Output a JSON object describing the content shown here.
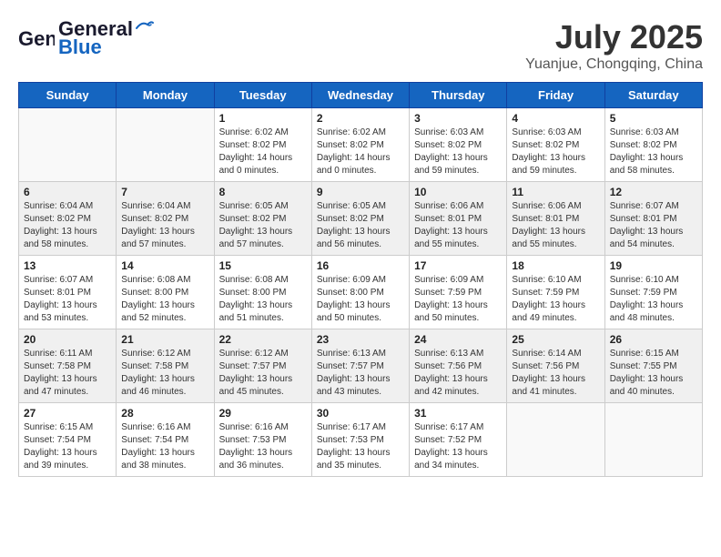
{
  "header": {
    "logo_general": "General",
    "logo_blue": "Blue",
    "title": "July 2025",
    "subtitle": "Yuanjue, Chongqing, China"
  },
  "days_of_week": [
    "Sunday",
    "Monday",
    "Tuesday",
    "Wednesday",
    "Thursday",
    "Friday",
    "Saturday"
  ],
  "weeks": [
    {
      "shaded": false,
      "days": [
        {
          "num": "",
          "empty": true
        },
        {
          "num": "",
          "empty": true
        },
        {
          "num": "1",
          "line1": "Sunrise: 6:02 AM",
          "line2": "Sunset: 8:02 PM",
          "line3": "Daylight: 14 hours",
          "line4": "and 0 minutes."
        },
        {
          "num": "2",
          "line1": "Sunrise: 6:02 AM",
          "line2": "Sunset: 8:02 PM",
          "line3": "Daylight: 14 hours",
          "line4": "and 0 minutes."
        },
        {
          "num": "3",
          "line1": "Sunrise: 6:03 AM",
          "line2": "Sunset: 8:02 PM",
          "line3": "Daylight: 13 hours",
          "line4": "and 59 minutes."
        },
        {
          "num": "4",
          "line1": "Sunrise: 6:03 AM",
          "line2": "Sunset: 8:02 PM",
          "line3": "Daylight: 13 hours",
          "line4": "and 59 minutes."
        },
        {
          "num": "5",
          "line1": "Sunrise: 6:03 AM",
          "line2": "Sunset: 8:02 PM",
          "line3": "Daylight: 13 hours",
          "line4": "and 58 minutes."
        }
      ]
    },
    {
      "shaded": true,
      "days": [
        {
          "num": "6",
          "line1": "Sunrise: 6:04 AM",
          "line2": "Sunset: 8:02 PM",
          "line3": "Daylight: 13 hours",
          "line4": "and 58 minutes."
        },
        {
          "num": "7",
          "line1": "Sunrise: 6:04 AM",
          "line2": "Sunset: 8:02 PM",
          "line3": "Daylight: 13 hours",
          "line4": "and 57 minutes."
        },
        {
          "num": "8",
          "line1": "Sunrise: 6:05 AM",
          "line2": "Sunset: 8:02 PM",
          "line3": "Daylight: 13 hours",
          "line4": "and 57 minutes."
        },
        {
          "num": "9",
          "line1": "Sunrise: 6:05 AM",
          "line2": "Sunset: 8:02 PM",
          "line3": "Daylight: 13 hours",
          "line4": "and 56 minutes."
        },
        {
          "num": "10",
          "line1": "Sunrise: 6:06 AM",
          "line2": "Sunset: 8:01 PM",
          "line3": "Daylight: 13 hours",
          "line4": "and 55 minutes."
        },
        {
          "num": "11",
          "line1": "Sunrise: 6:06 AM",
          "line2": "Sunset: 8:01 PM",
          "line3": "Daylight: 13 hours",
          "line4": "and 55 minutes."
        },
        {
          "num": "12",
          "line1": "Sunrise: 6:07 AM",
          "line2": "Sunset: 8:01 PM",
          "line3": "Daylight: 13 hours",
          "line4": "and 54 minutes."
        }
      ]
    },
    {
      "shaded": false,
      "days": [
        {
          "num": "13",
          "line1": "Sunrise: 6:07 AM",
          "line2": "Sunset: 8:01 PM",
          "line3": "Daylight: 13 hours",
          "line4": "and 53 minutes."
        },
        {
          "num": "14",
          "line1": "Sunrise: 6:08 AM",
          "line2": "Sunset: 8:00 PM",
          "line3": "Daylight: 13 hours",
          "line4": "and 52 minutes."
        },
        {
          "num": "15",
          "line1": "Sunrise: 6:08 AM",
          "line2": "Sunset: 8:00 PM",
          "line3": "Daylight: 13 hours",
          "line4": "and 51 minutes."
        },
        {
          "num": "16",
          "line1": "Sunrise: 6:09 AM",
          "line2": "Sunset: 8:00 PM",
          "line3": "Daylight: 13 hours",
          "line4": "and 50 minutes."
        },
        {
          "num": "17",
          "line1": "Sunrise: 6:09 AM",
          "line2": "Sunset: 7:59 PM",
          "line3": "Daylight: 13 hours",
          "line4": "and 50 minutes."
        },
        {
          "num": "18",
          "line1": "Sunrise: 6:10 AM",
          "line2": "Sunset: 7:59 PM",
          "line3": "Daylight: 13 hours",
          "line4": "and 49 minutes."
        },
        {
          "num": "19",
          "line1": "Sunrise: 6:10 AM",
          "line2": "Sunset: 7:59 PM",
          "line3": "Daylight: 13 hours",
          "line4": "and 48 minutes."
        }
      ]
    },
    {
      "shaded": true,
      "days": [
        {
          "num": "20",
          "line1": "Sunrise: 6:11 AM",
          "line2": "Sunset: 7:58 PM",
          "line3": "Daylight: 13 hours",
          "line4": "and 47 minutes."
        },
        {
          "num": "21",
          "line1": "Sunrise: 6:12 AM",
          "line2": "Sunset: 7:58 PM",
          "line3": "Daylight: 13 hours",
          "line4": "and 46 minutes."
        },
        {
          "num": "22",
          "line1": "Sunrise: 6:12 AM",
          "line2": "Sunset: 7:57 PM",
          "line3": "Daylight: 13 hours",
          "line4": "and 45 minutes."
        },
        {
          "num": "23",
          "line1": "Sunrise: 6:13 AM",
          "line2": "Sunset: 7:57 PM",
          "line3": "Daylight: 13 hours",
          "line4": "and 43 minutes."
        },
        {
          "num": "24",
          "line1": "Sunrise: 6:13 AM",
          "line2": "Sunset: 7:56 PM",
          "line3": "Daylight: 13 hours",
          "line4": "and 42 minutes."
        },
        {
          "num": "25",
          "line1": "Sunrise: 6:14 AM",
          "line2": "Sunset: 7:56 PM",
          "line3": "Daylight: 13 hours",
          "line4": "and 41 minutes."
        },
        {
          "num": "26",
          "line1": "Sunrise: 6:15 AM",
          "line2": "Sunset: 7:55 PM",
          "line3": "Daylight: 13 hours",
          "line4": "and 40 minutes."
        }
      ]
    },
    {
      "shaded": false,
      "days": [
        {
          "num": "27",
          "line1": "Sunrise: 6:15 AM",
          "line2": "Sunset: 7:54 PM",
          "line3": "Daylight: 13 hours",
          "line4": "and 39 minutes."
        },
        {
          "num": "28",
          "line1": "Sunrise: 6:16 AM",
          "line2": "Sunset: 7:54 PM",
          "line3": "Daylight: 13 hours",
          "line4": "and 38 minutes."
        },
        {
          "num": "29",
          "line1": "Sunrise: 6:16 AM",
          "line2": "Sunset: 7:53 PM",
          "line3": "Daylight: 13 hours",
          "line4": "and 36 minutes."
        },
        {
          "num": "30",
          "line1": "Sunrise: 6:17 AM",
          "line2": "Sunset: 7:53 PM",
          "line3": "Daylight: 13 hours",
          "line4": "and 35 minutes."
        },
        {
          "num": "31",
          "line1": "Sunrise: 6:17 AM",
          "line2": "Sunset: 7:52 PM",
          "line3": "Daylight: 13 hours",
          "line4": "and 34 minutes."
        },
        {
          "num": "",
          "empty": true
        },
        {
          "num": "",
          "empty": true
        }
      ]
    }
  ]
}
